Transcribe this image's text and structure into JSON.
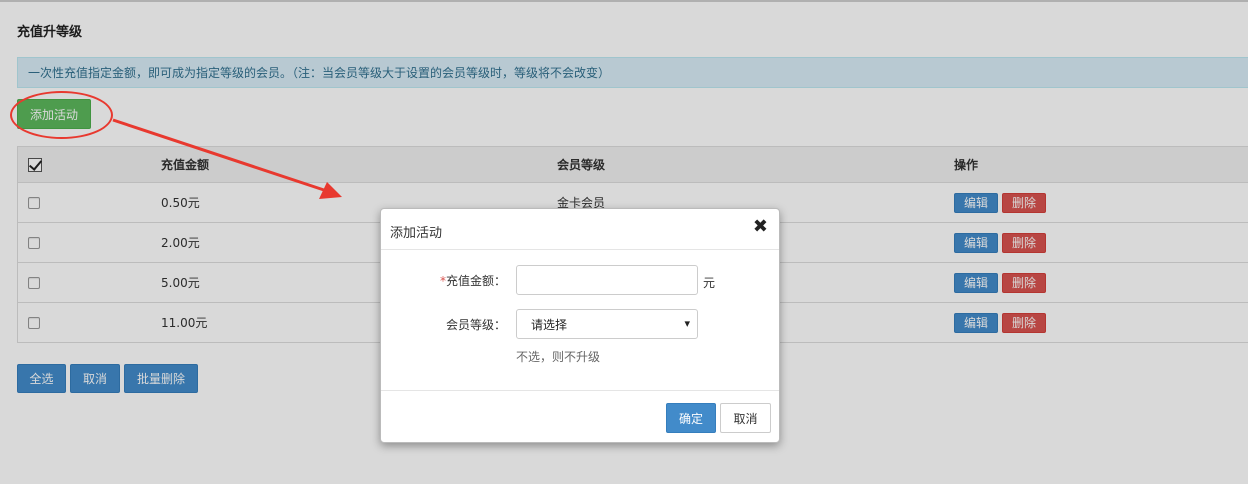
{
  "page": {
    "title": "充值升等级",
    "info": "一次性充值指定金额，即可成为指定等级的会员。（注：当会员等级大于设置的会员等级时，等级将不会改变）",
    "add_button": "添加活动"
  },
  "table": {
    "headers": {
      "amount": "充值金额",
      "level": "会员等级",
      "ops": "操作"
    },
    "rows": [
      {
        "amount": "0.50元",
        "level": "金卡会员"
      },
      {
        "amount": "2.00元",
        "level": ""
      },
      {
        "amount": "5.00元",
        "level": ""
      },
      {
        "amount": "11.00元",
        "level": ""
      }
    ],
    "edit_label": "编辑",
    "delete_label": "删除"
  },
  "bulk": {
    "select_all": "全选",
    "cancel": "取消",
    "batch_delete": "批量删除"
  },
  "modal": {
    "title": "添加活动",
    "close_glyph": "✖",
    "amount_label": "充值金额：",
    "required_mark": "*",
    "amount_value": "",
    "amount_unit": "元",
    "level_label": "会员等级：",
    "level_selected": "请选择",
    "level_hint": "不选，则不升级",
    "confirm": "确定",
    "cancel": "取消"
  },
  "icons": {
    "select_arrow": "▾",
    "close": "close-icon"
  },
  "colors": {
    "primary": "#428bca",
    "success": "#5cb85c",
    "danger": "#d9534f",
    "annotation": "#e8392f",
    "info_bg": "#d9edf7"
  }
}
